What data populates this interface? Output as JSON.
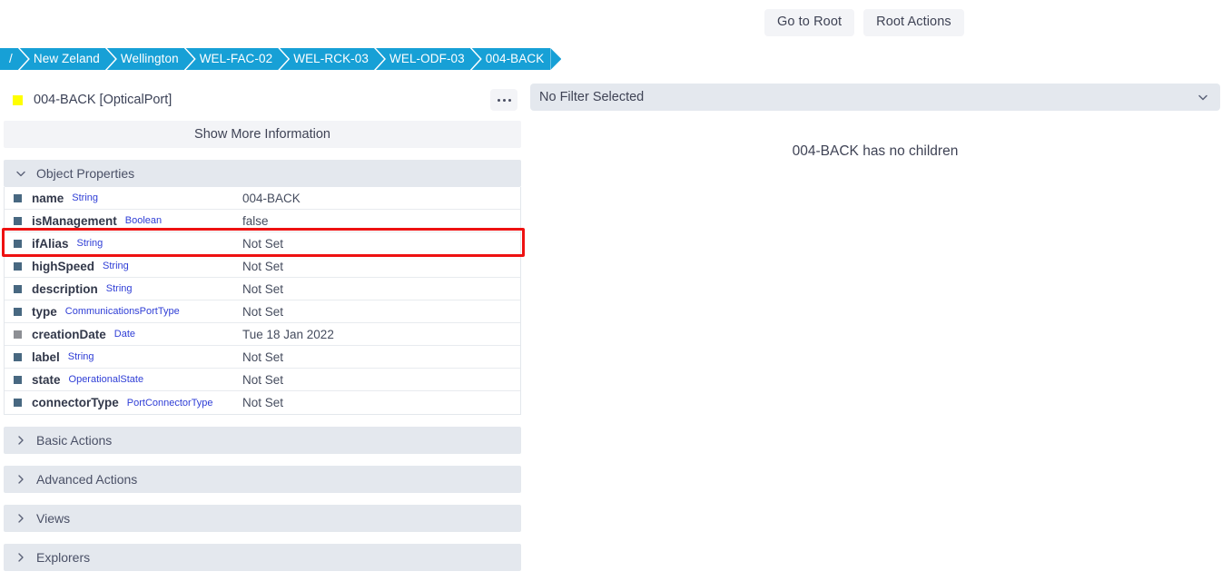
{
  "toolbar": {
    "go_to_root": "Go to Root",
    "root_actions": "Root Actions"
  },
  "breadcrumb": {
    "items": [
      {
        "label": "/"
      },
      {
        "label": "New Zeland"
      },
      {
        "label": "Wellington"
      },
      {
        "label": "WEL-FAC-02"
      },
      {
        "label": "WEL-RCK-03"
      },
      {
        "label": "WEL-ODF-03"
      },
      {
        "label": "004-BACK"
      }
    ]
  },
  "object": {
    "swatch_color": "#ffff00",
    "title": "004-BACK [OpticalPort]",
    "more_menu_icon": "kebab-icon",
    "show_more_label": "Show More Information"
  },
  "properties_section": {
    "title": "Object Properties",
    "expanded": true,
    "rows": [
      {
        "name": "name",
        "type": "String",
        "value": "004-BACK",
        "marker": "blue"
      },
      {
        "name": "isManagement",
        "type": "Boolean",
        "value": "false",
        "marker": "blue"
      },
      {
        "name": "ifAlias",
        "type": "String",
        "value": "Not Set",
        "marker": "blue"
      },
      {
        "name": "highSpeed",
        "type": "String",
        "value": "Not Set",
        "marker": "blue"
      },
      {
        "name": "description",
        "type": "String",
        "value": "Not Set",
        "marker": "blue"
      },
      {
        "name": "type",
        "type": "CommunicationsPortType",
        "value": "Not Set",
        "marker": "blue"
      },
      {
        "name": "creationDate",
        "type": "Date",
        "value": "Tue 18 Jan 2022",
        "marker": "gray"
      },
      {
        "name": "label",
        "type": "String",
        "value": "Not Set",
        "marker": "blue"
      },
      {
        "name": "state",
        "type": "OperationalState",
        "value": "Not Set",
        "marker": "blue"
      },
      {
        "name": "connectorType",
        "type": "PortConnectorType",
        "value": "Not Set",
        "marker": "blue"
      }
    ]
  },
  "accordions": [
    {
      "label": "Basic Actions"
    },
    {
      "label": "Advanced Actions"
    },
    {
      "label": "Views"
    },
    {
      "label": "Explorers"
    }
  ],
  "right_panel": {
    "filter_label": "No Filter Selected",
    "filter_icon": "chevron-down-icon",
    "empty_message": "004-BACK has no children"
  },
  "annotation": {
    "highlight_color": "#ee1111",
    "highlight_target": "isManagement"
  }
}
